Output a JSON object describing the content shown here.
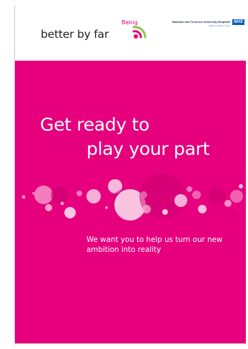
{
  "header": {
    "logo": {
      "being": "Being",
      "main": "better by far"
    },
    "trust": {
      "name": "Basildon and Thurrock University Hospitals",
      "subtitle": "NHS Foundation Trust",
      "nhs_badge": "NHS"
    }
  },
  "cover": {
    "headline_line1": "Get ready to",
    "headline_line2": "play your part",
    "body": "We want you to help us turn our new ambition into reality"
  },
  "colors": {
    "brand_magenta": "#e6007e",
    "logo_green": "#8dc63f",
    "logo_magenta": "#e6007e",
    "nhs_blue": "#005eb8"
  }
}
